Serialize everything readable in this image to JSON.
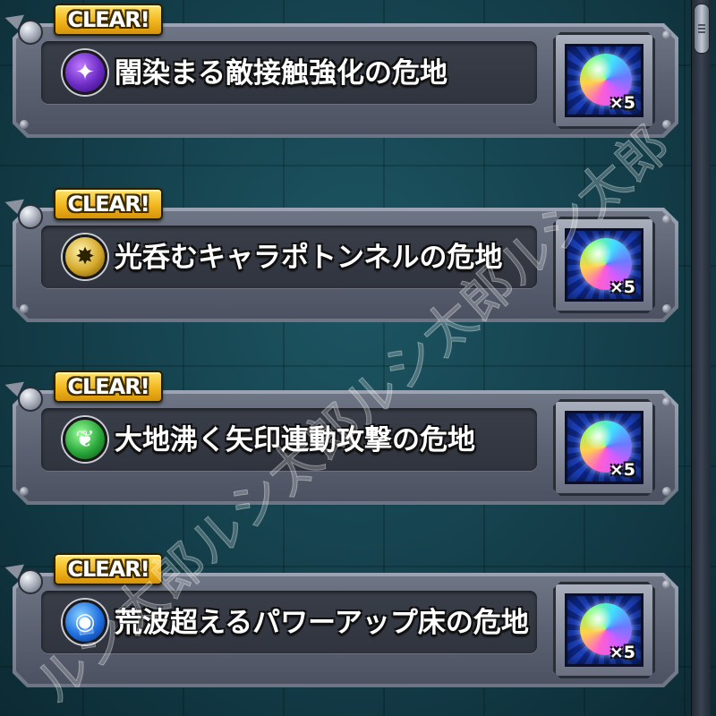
{
  "quests": [
    {
      "badge": "CLEAR!",
      "element": "dark",
      "icon_glyph": "✦",
      "title": "闇染まる敵接触強化の危地",
      "reward_count": "×5"
    },
    {
      "badge": "CLEAR!",
      "element": "light",
      "icon_glyph": "✸",
      "title": "光呑むキャラポトンネルの危地",
      "reward_count": "×5"
    },
    {
      "badge": "CLEAR!",
      "element": "wood",
      "icon_glyph": "❦",
      "title": "大地沸く矢印連動攻撃の危地",
      "reward_count": "×5"
    },
    {
      "badge": "CLEAR!",
      "element": "water",
      "icon_glyph": "◉",
      "title": "荒波超えるパワーアップ床の危地",
      "reward_count": "×5"
    }
  ],
  "icons": {
    "reward": "rainbow-orb-icon",
    "element_dark": "dark-element-icon",
    "element_light": "light-element-icon",
    "element_wood": "wood-element-icon",
    "element_water": "water-element-icon"
  },
  "colors": {
    "background": "#123a45",
    "badge": "#f2b61d",
    "panel": "#6e7584",
    "reward_bg": "#1b3fb8"
  },
  "watermark": {
    "text": "ルシ太郎ルシ太郎ルシ太郎ルシ太郎"
  }
}
